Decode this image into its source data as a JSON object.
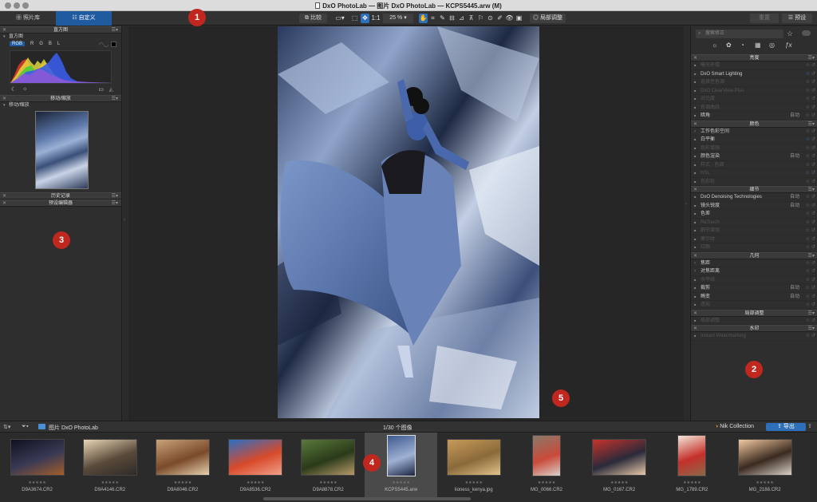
{
  "window": {
    "title": "DxO PhotoLab — 图片 DxO PhotoLab — KCPS5445.arw (M)"
  },
  "toolbar": {
    "tab_library": "照片库",
    "tab_customize": "自定义",
    "compare_label": "比较",
    "ratio_label": "1:1",
    "zoom_label": "25 %",
    "local_adjust_label": "局部调整",
    "reset_label": "重置",
    "preset_label": "预设"
  },
  "left_panel": {
    "histogram_title": "直方图",
    "histogram_sub": "直方图",
    "channels": [
      "RGB",
      "R",
      "G",
      "B",
      "L"
    ],
    "move_zoom_title": "移动/缩放",
    "move_zoom_sub": "移动/缩放",
    "history_title": "历史记录",
    "preset_editor_title": "预设编辑器"
  },
  "right_panel": {
    "search_placeholder": "搜索修正",
    "sections": [
      {
        "title": "亮度",
        "rows": [
          {
            "label": "曝光补偿",
            "on": false,
            "auto": "",
            "star": false
          },
          {
            "label": "DxO Smart Lighting",
            "on": true,
            "auto": "",
            "star": true
          },
          {
            "label": "选择性色调",
            "on": false,
            "auto": "",
            "star": false
          },
          {
            "label": "DxO ClearView Plus",
            "on": false,
            "auto": "",
            "star": false
          },
          {
            "label": "对比度",
            "on": false,
            "auto": "",
            "star": false
          },
          {
            "label": "色调曲线",
            "on": false,
            "auto": "",
            "star": false
          },
          {
            "label": "暗角",
            "on": true,
            "auto": "自动",
            "star": false
          }
        ]
      },
      {
        "title": "颜色",
        "rows": [
          {
            "label": "工作色彩空间",
            "on": true,
            "auto": "",
            "star": false,
            "tri": true
          },
          {
            "label": "白平衡",
            "on": true,
            "auto": "",
            "star": true
          },
          {
            "label": "色彩增强",
            "on": false,
            "auto": "",
            "star": false
          },
          {
            "label": "颜色渲染",
            "on": true,
            "auto": "自动",
            "star": false
          },
          {
            "label": "样式 - 色调",
            "on": false,
            "auto": "",
            "star": false
          },
          {
            "label": "HSL",
            "on": false,
            "auto": "",
            "star": true
          },
          {
            "label": "色彩轮",
            "on": false,
            "auto": "",
            "star": false
          }
        ]
      },
      {
        "title": "细节",
        "rows": [
          {
            "label": "DxO Denoising Technologies",
            "on": true,
            "auto": "自动",
            "star": false
          },
          {
            "label": "镜头锐度",
            "on": true,
            "auto": "自动",
            "star": false
          },
          {
            "label": "色差",
            "on": true,
            "auto": "",
            "star": false
          },
          {
            "label": "ReTouch",
            "on": false,
            "auto": "",
            "star": false
          },
          {
            "label": "细节增强",
            "on": false,
            "auto": "",
            "star": false
          },
          {
            "label": "摩尔纹",
            "on": false,
            "auto": "",
            "star": false
          },
          {
            "label": "红眼",
            "on": false,
            "auto": "",
            "star": false
          }
        ]
      },
      {
        "title": "几何",
        "rows": [
          {
            "label": "焦距",
            "on": true,
            "auto": "",
            "star": false,
            "tri": true
          },
          {
            "label": "对焦距离",
            "on": true,
            "auto": "",
            "star": false,
            "tri": true
          },
          {
            "label": "水平线",
            "on": false,
            "auto": "",
            "star": false
          },
          {
            "label": "裁剪",
            "on": true,
            "auto": "自动",
            "star": false
          },
          {
            "label": "畸变",
            "on": true,
            "auto": "自动",
            "star": false
          },
          {
            "label": "透视",
            "on": false,
            "auto": "",
            "star": false
          }
        ]
      },
      {
        "title": "局部调整",
        "rows": [
          {
            "label": "局部调整",
            "on": false,
            "auto": "",
            "star": false
          }
        ]
      },
      {
        "title": "水印",
        "rows": [
          {
            "label": "Instant Watermarking",
            "on": false,
            "auto": "",
            "star": false
          }
        ]
      }
    ]
  },
  "filmbar": {
    "folder_label": "图片 DxO PhotoLab",
    "count_label": "1/30 个图像",
    "nik_label": "Nik Collection",
    "export_label": "导出"
  },
  "filmstrip": [
    {
      "name": "D9A3674.CR2",
      "selected": false
    },
    {
      "name": "D9A4146.CR2",
      "selected": false
    },
    {
      "name": "D9A8046.CR2",
      "selected": false
    },
    {
      "name": "D9A8536.CR2",
      "selected": false
    },
    {
      "name": "D9A8878.CR2",
      "selected": false
    },
    {
      "name": "KCPS5445.arw",
      "selected": true
    },
    {
      "name": "lioness_kenya.jpg",
      "selected": false
    },
    {
      "name": "MG_0066.CR2",
      "selected": false
    },
    {
      "name": "MG_0167.CR2",
      "selected": false
    },
    {
      "name": "MG_1789.CR2",
      "selected": false
    },
    {
      "name": "MG_2188.CR2",
      "selected": false
    }
  ],
  "badges": [
    "1",
    "2",
    "3",
    "4",
    "5"
  ]
}
